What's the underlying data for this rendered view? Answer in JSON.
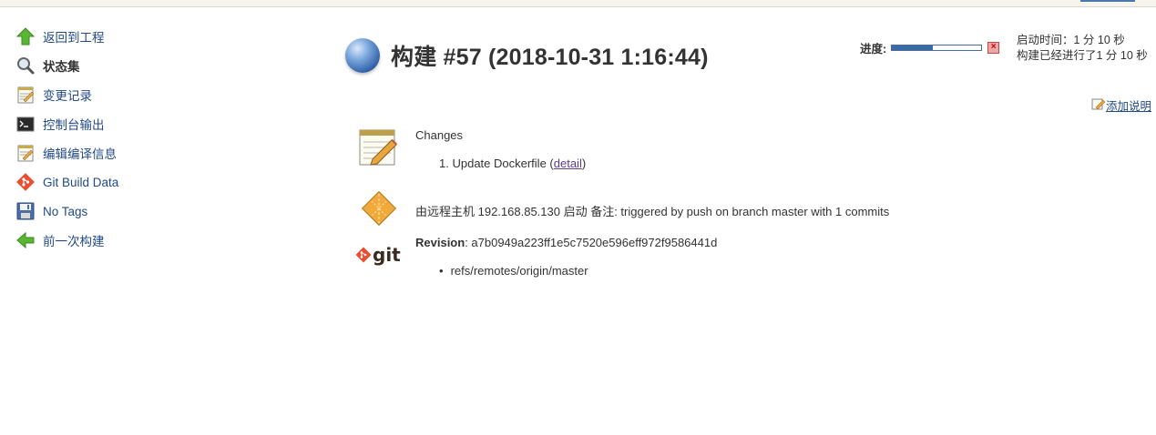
{
  "sidebar": {
    "items": [
      {
        "label": "返回到工程",
        "icon": "arrow-up-icon"
      },
      {
        "label": "状态集",
        "icon": "magnifier-icon"
      },
      {
        "label": "变更记录",
        "icon": "notepad-icon"
      },
      {
        "label": "控制台输出",
        "icon": "terminal-icon"
      },
      {
        "label": "编辑编译信息",
        "icon": "notepad-edit-icon"
      },
      {
        "label": "Git Build Data",
        "icon": "git-icon"
      },
      {
        "label": "No Tags",
        "icon": "floppy-icon"
      },
      {
        "label": "前一次构建",
        "icon": "arrow-left-icon"
      }
    ]
  },
  "build": {
    "title": "构建 #57 (2018-10-31 1:16:44)",
    "progress_label": "进度:",
    "progress": 0.46,
    "start_time": "启动时间：1 分 10 秒",
    "elapsed": "构建已经进行了1 分 10 秒",
    "add_description": "添加说明"
  },
  "changes": {
    "title": "Changes",
    "items": [
      {
        "number": "1.",
        "text": "Update Dockerfile",
        "link": "detail"
      }
    ]
  },
  "cause": {
    "text": "由远程主机 192.168.85.130 启动 备注: triggered by push on branch master with 1 commits"
  },
  "git": {
    "logo_text": "git",
    "revision_label": "Revision",
    "revision_value": ": a7b0949a223ff1e5c7520e596eff972f9586441d",
    "branches": [
      "refs/remotes/origin/master"
    ]
  },
  "colors": {
    "link": "#204a87",
    "progress_fill": "#3a6aa6",
    "git_red": "#e84e31"
  }
}
